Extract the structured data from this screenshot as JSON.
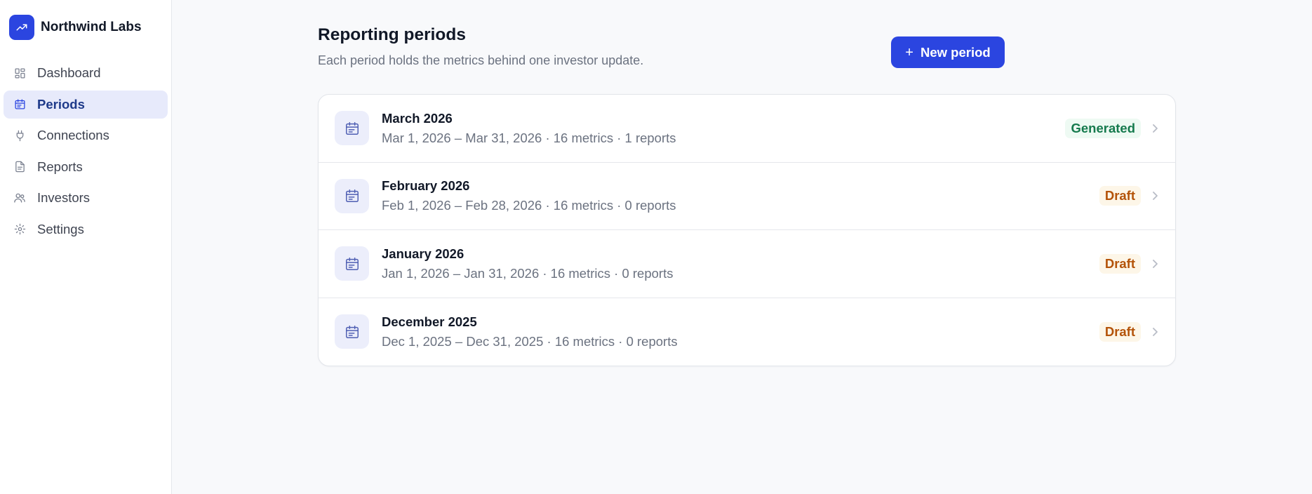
{
  "brand": {
    "name": "Northwind Labs",
    "icon": "trending-up-icon"
  },
  "sidebar": {
    "items": [
      {
        "label": "Dashboard",
        "icon": "grid-icon",
        "active": false
      },
      {
        "label": "Periods",
        "icon": "calendar-icon",
        "active": true
      },
      {
        "label": "Connections",
        "icon": "plug-icon",
        "active": false
      },
      {
        "label": "Reports",
        "icon": "document-icon",
        "active": false
      },
      {
        "label": "Investors",
        "icon": "users-icon",
        "active": false
      },
      {
        "label": "Settings",
        "icon": "gear-icon",
        "active": false
      }
    ]
  },
  "header": {
    "title": "Reporting periods",
    "subtitle": "Each period holds the metrics behind one investor update.",
    "new_button_label": "New period"
  },
  "periods": [
    {
      "title": "March 2026",
      "details": "Mar 1, 2026 – Mar 31, 2026 · 16 metrics · 1 reports",
      "status": "Generated"
    },
    {
      "title": "February 2026",
      "details": "Feb 1, 2026 – Feb 28, 2026 · 16 metrics · 0 reports",
      "status": "Draft"
    },
    {
      "title": "January 2026",
      "details": "Jan 1, 2026 – Jan 31, 2026 · 16 metrics · 0 reports",
      "status": "Draft"
    },
    {
      "title": "December 2025",
      "details": "Dec 1, 2025 – Dec 31, 2025 · 16 metrics · 0 reports",
      "status": "Draft"
    }
  ],
  "colors": {
    "accent": "#2b45e0",
    "active_nav_bg": "#e7eafb",
    "generated": "#157a4d",
    "draft": "#b45309"
  }
}
